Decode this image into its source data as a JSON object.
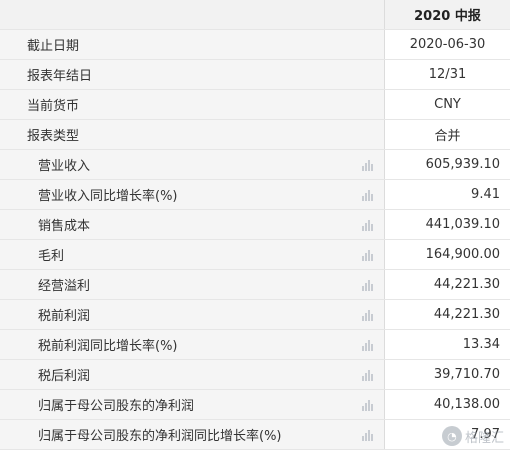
{
  "header": {
    "period": "2020 中报"
  },
  "meta_rows": [
    {
      "label": "截止日期",
      "value": "2020-06-30"
    },
    {
      "label": "报表年结日",
      "value": "12/31"
    },
    {
      "label": "当前货币",
      "value": "CNY"
    },
    {
      "label": "报表类型",
      "value": "合并"
    }
  ],
  "data_rows": [
    {
      "label": "营业收入",
      "value": "605,939.10"
    },
    {
      "label": "营业收入同比增长率(%)",
      "value": "9.41"
    },
    {
      "label": "销售成本",
      "value": "441,039.10"
    },
    {
      "label": "毛利",
      "value": "164,900.00"
    },
    {
      "label": "经营溢利",
      "value": "44,221.30"
    },
    {
      "label": "税前利润",
      "value": "44,221.30"
    },
    {
      "label": "税前利润同比增长率(%)",
      "value": "13.34"
    },
    {
      "label": "税后利润",
      "value": "39,710.70"
    },
    {
      "label": "归属于母公司股东的净利润",
      "value": "40,138.00"
    },
    {
      "label": "归属于母公司股东的净利润同比增长率(%)",
      "value": "7.97"
    }
  ],
  "icons": {
    "row_chart": "bar-chart-icon"
  },
  "watermark": {
    "text": "格隆汇"
  },
  "colors": {
    "label_bg": "#f5f5f5",
    "header_bg": "#f2f2f2",
    "border": "#e6e6e6",
    "icon": "#c8ccd2"
  }
}
